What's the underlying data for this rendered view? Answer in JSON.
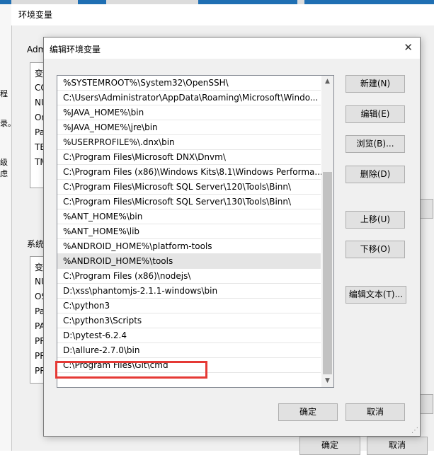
{
  "bg_window": {
    "title": "环境变量",
    "user_group_label": "Adm",
    "system_group_label": "系统",
    "user_list_rows": [
      "变",
      "CO",
      "NU",
      "On",
      "Pa",
      "TE",
      "TM"
    ],
    "system_list_rows": [
      "变",
      "NU",
      "OS",
      "Pa",
      "PA",
      "PR",
      "PR",
      "PR"
    ],
    "left_snippets": [
      "程",
      "录。",
      "级虑"
    ],
    "ok_label": "确定",
    "cancel_label": "取消"
  },
  "dialog": {
    "title": "编辑环境变量",
    "close_glyph": "✕",
    "paths": [
      "%SYSTEMROOT%\\System32\\OpenSSH\\",
      "C:\\Users\\Administrator\\AppData\\Roaming\\Microsoft\\Windo...",
      "%JAVA_HOME%\\bin",
      "%JAVA_HOME%\\jre\\bin",
      "%USERPROFILE%\\.dnx\\bin",
      "C:\\Program Files\\Microsoft DNX\\Dnvm\\",
      "C:\\Program Files (x86)\\Windows Kits\\8.1\\Windows Performa...",
      "C:\\Program Files\\Microsoft SQL Server\\120\\Tools\\Binn\\",
      "C:\\Program Files\\Microsoft SQL Server\\130\\Tools\\Binn\\",
      "%ANT_HOME%\\bin",
      "%ANT_HOME%\\lib",
      "%ANDROID_HOME%\\platform-tools",
      "%ANDROID_HOME%\\tools",
      "C:\\Program Files (x86)\\nodejs\\",
      "D:\\xss\\phantomjs-2.1.1-windows\\bin",
      "C:\\python3",
      "C:\\python3\\Scripts",
      "D:\\pytest-6.2.4",
      "D:\\allure-2.7.0\\bin",
      "C:\\Program Files\\Git\\cmd"
    ],
    "buttons": {
      "new": "新建(N)",
      "edit": "编辑(E)",
      "browse": "浏览(B)...",
      "delete": "删除(D)",
      "move_up": "上移(U)",
      "move_down": "下移(O)",
      "edit_text": "编辑文本(T)...",
      "ok": "确定",
      "cancel": "取消"
    }
  },
  "colors": {
    "highlight_box": "#e53935",
    "selected_row": "#e5e5e5"
  }
}
